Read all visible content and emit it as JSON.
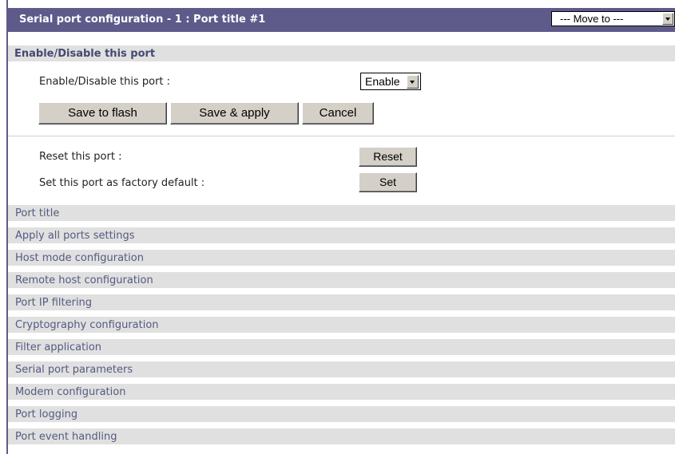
{
  "header": {
    "title": "Serial port configuration - 1 : Port title #1",
    "move_to": "--- Move to ---"
  },
  "enable_section": {
    "title": "Enable/Disable this port",
    "field_label": "Enable/Disable this port :",
    "selected_value": "Enable",
    "buttons": {
      "save_flash": "Save to flash",
      "save_apply": "Save & apply",
      "cancel": "Cancel"
    }
  },
  "actions": {
    "reset_label": "Reset this port :",
    "reset_button": "Reset",
    "default_label": "Set this port as factory default :",
    "set_button": "Set"
  },
  "links": [
    "Port title",
    "Apply all ports settings",
    "Host mode configuration",
    "Remote host configuration",
    "Port IP filtering",
    "Cryptography configuration",
    "Filter application",
    "Serial port parameters",
    "Modem configuration",
    "Port logging",
    "Port event handling"
  ]
}
